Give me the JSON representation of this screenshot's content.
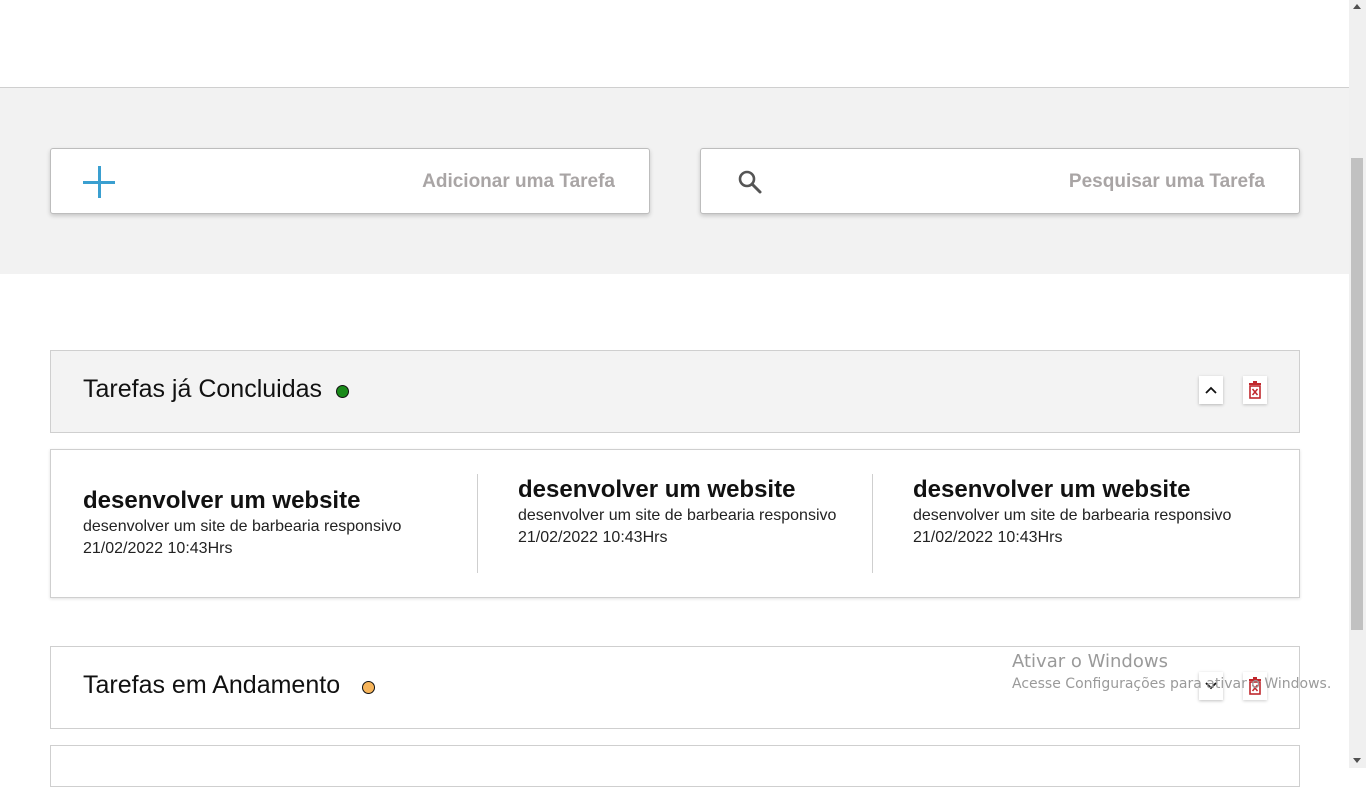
{
  "toolbar": {
    "add_placeholder": "Adicionar uma Tarefa",
    "search_placeholder": "Pesquisar uma Tarefa"
  },
  "sections": {
    "done": {
      "title": "Tarefas já Concluidas",
      "status_color": "#1a8a1a",
      "expanded": true
    },
    "in_progress": {
      "title": "Tarefas em Andamento",
      "status_color": "#f7b55b",
      "expanded": false
    }
  },
  "done_tasks": [
    {
      "title": "desenvolver um website",
      "description": "desenvolver um site de barbearia responsivo",
      "date": "21/02/2022 10:43Hrs"
    },
    {
      "title": "desenvolver um website",
      "description": "desenvolver um site de barbearia responsivo",
      "date": "21/02/2022 10:43Hrs"
    },
    {
      "title": "desenvolver um website",
      "description": "desenvolver um site de barbearia responsivo",
      "date": "21/02/2022 10:43Hrs"
    }
  ],
  "watermark": {
    "title": "Ativar o Windows",
    "subtitle": "Acesse Configurações para ativar o Windows."
  },
  "colors": {
    "accent_blue": "#3a9fd0",
    "delete_red": "#c0282d"
  }
}
